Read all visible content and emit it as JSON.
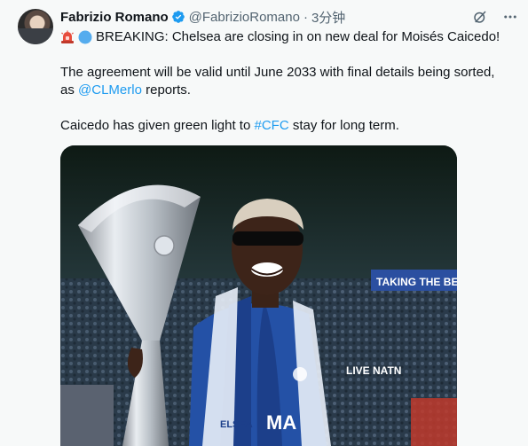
{
  "author": {
    "name": "Fabrizio Romano",
    "handle": "@FabrizioRomano",
    "separator": "·",
    "time": "3分钟"
  },
  "icons": {
    "verified": "verified-badge-icon",
    "grok": "grok-icon",
    "more": "more-icon",
    "siren": "siren-emoji-icon",
    "blue_circle": "blue-circle-emoji-icon"
  },
  "tweet": {
    "line1": "BREAKING: Chelsea are closing in on new deal for Moisés Caicedo!",
    "p2_prefix": "The agreement will be valid until June 2033 with final details being sorted,",
    "p2_as": "as ",
    "p2_mention": "@CLMerlo",
    "p2_suffix": " reports.",
    "p3_prefix": "Caicedo has given green light to ",
    "p3_hashtag": "#CFC",
    "p3_suffix": " stay for long term."
  },
  "media": {
    "banner_text": "TAKING THE BE",
    "shirt_sponsor": "LIVE NATN",
    "scarf_text": "ELSEA",
    "shirt_letters": "MA"
  },
  "colors": {
    "link": "#1d9bf0",
    "verified": "#1d9bf0",
    "text": "#0f1419",
    "muted": "#536471"
  }
}
